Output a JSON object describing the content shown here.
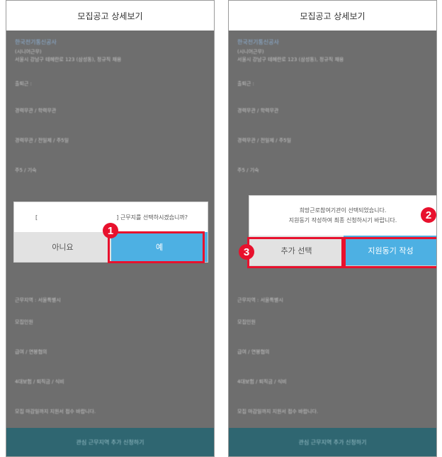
{
  "screens": [
    {
      "header_title": "모집공고 상세보기",
      "company_name": "한국전기통신공사",
      "company_sub1": "(시니어근무)",
      "company_sub2": "서울시 강남구 테헤란로 123 (삼성동), 정규직 채용",
      "fields": [
        "출퇴근 :",
        "경력무관 / 학력무관",
        "경력무관 / 전일제 / 주5일",
        "주5 / 기숙"
      ],
      "dialog": {
        "message_left": "[",
        "message_right": "] 근무지를 선택하시겠습니까?",
        "cancel_label": "아니요",
        "confirm_label": "예"
      },
      "marker_label": "1",
      "lower_fields": [
        "근무지역 : 서울특별시",
        "모집인원",
        "급여 / 연봉협의",
        "4대보험 / 퇴직금 / 식비",
        "모집 마감일까지 지원서 접수 바랍니다."
      ],
      "bottom_bar_label": "관심 근무지역 추가 신청하기"
    },
    {
      "header_title": "모집공고 상세보기",
      "company_name": "한국전기통신공사",
      "company_sub1": "(시니어근무)",
      "company_sub2": "서울시 강남구 테헤란로 123 (삼성동), 정규직 채용",
      "fields": [
        "출퇴근 :",
        "경력무관 / 학력무관",
        "경력무관 / 전일제 / 주5일",
        "주5 / 기숙"
      ],
      "dialog": {
        "message_line1": "희망근로참여기관이 선택되었습니다.",
        "message_line2": "지원동기 작성하여 최종 신청하시기 바랍니다.",
        "add_label": "추가 선택",
        "write_label": "지원동기 작성"
      },
      "marker_2_label": "2",
      "marker_3_label": "3",
      "lower_fields": [
        "근무지역 : 서울특별시",
        "모집인원",
        "급여 / 연봉협의",
        "4대보험 / 퇴직금 / 식비",
        "모집 마감일까지 지원서 접수 바랍니다."
      ],
      "bottom_bar_label": "관심 근무지역 추가 신청하기"
    }
  ],
  "colors": {
    "overlay": "#6e6e6e",
    "header_bg": "#ffffff",
    "dialog_confirm": "#4db0e3",
    "dialog_cancel": "#e2e2e2",
    "highlight": "#e8112d",
    "bottom_bar": "#2f6671"
  }
}
